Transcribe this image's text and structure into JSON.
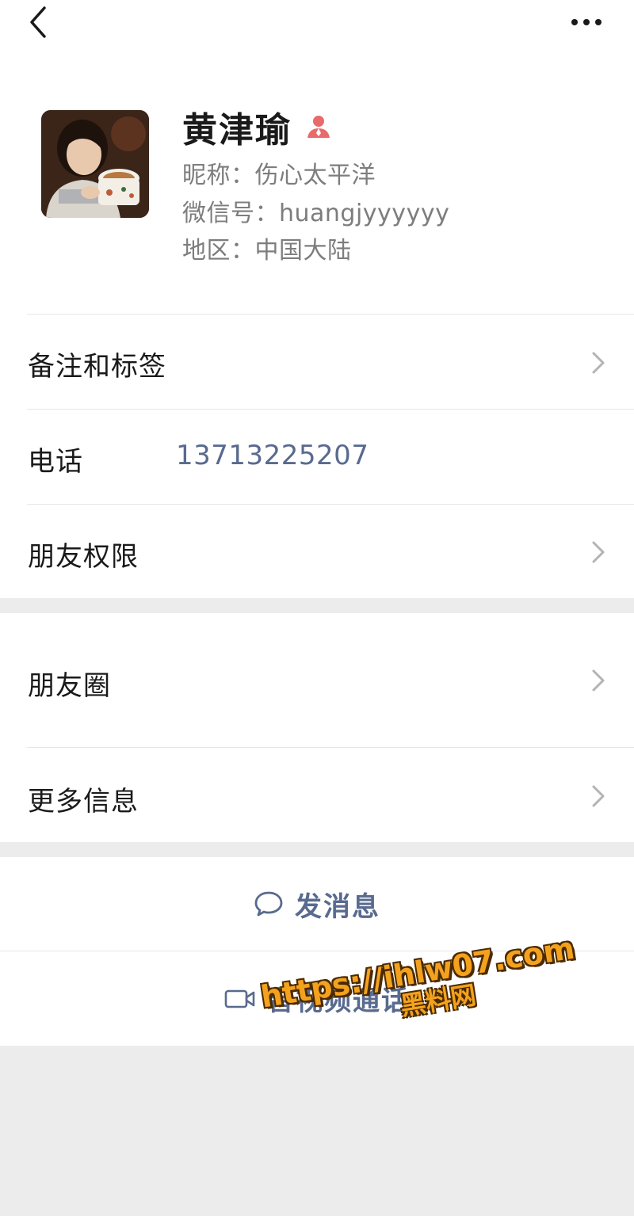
{
  "header": {
    "back_icon": "chevron-left-icon",
    "more_icon": "more-dots-icon"
  },
  "profile": {
    "name": "黄津瑜",
    "gender_icon": "female-icon",
    "nickname": "昵称：伤心太平洋",
    "wechat_id": "微信号：huangjyyyyyy",
    "region": "地区：中国大陆"
  },
  "rows": {
    "remarks_label": "备注和标签",
    "phone_label": "电话",
    "phone_value": "13713225207",
    "permissions_label": "朋友权限",
    "moments_label": "朋友圈",
    "more_info_label": "更多信息"
  },
  "actions": {
    "message_label": "发消息",
    "message_icon": "chat-bubble-icon",
    "call_label": "音视频通话",
    "call_icon": "video-camera-icon"
  },
  "watermark": {
    "url": "https://ihlw07.com",
    "name": "黑料网"
  },
  "colors": {
    "link_blue": "#596a8f",
    "background_gray": "#ececec",
    "watermark_orange": "#f4a21e"
  }
}
